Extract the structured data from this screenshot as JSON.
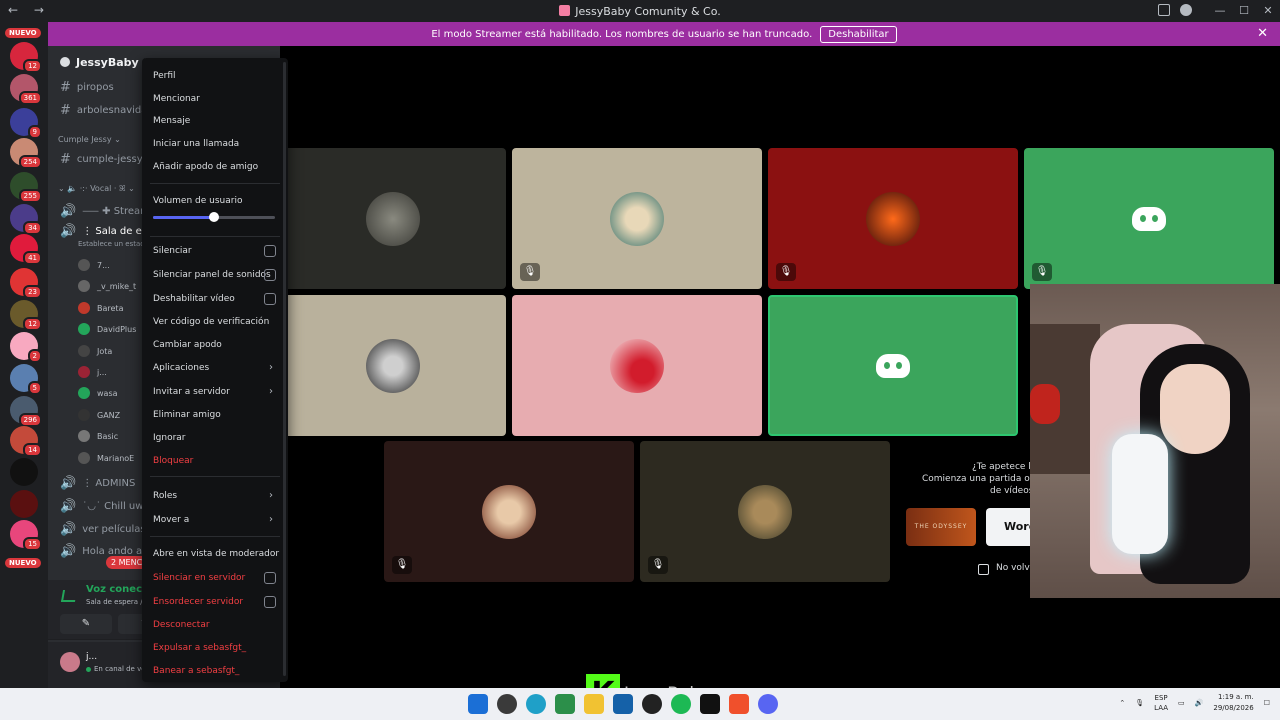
{
  "window": {
    "title": "JessyBaby Comunity & Co.",
    "nav": "← →"
  },
  "banner": {
    "text": "El modo Streamer está habilitado. Los nombres de usuario se han truncado.",
    "button": "Deshabilitar",
    "close": "✕"
  },
  "rail": {
    "top_badge": "NUEVO",
    "bottom_badge": "NUEVO",
    "servers": [
      {
        "badge": "12",
        "color": "#d7263d"
      },
      {
        "badge": "361",
        "color": "#b3566a"
      },
      {
        "badge": "9",
        "color": "#3b3f9a"
      },
      {
        "badge": "254",
        "color": "#c98a74"
      },
      {
        "badge": "255",
        "color": "#2e4d2b"
      },
      {
        "badge": "34",
        "color": "#4b3c8a"
      },
      {
        "badge": "41",
        "color": "#e01b3c"
      },
      {
        "badge": "23",
        "color": "#e03434"
      },
      {
        "badge": "12",
        "color": "#6a5a2b"
      },
      {
        "badge": "2",
        "color": "#f8a9c0"
      },
      {
        "badge": "5",
        "color": "#5a7fb0"
      },
      {
        "badge": "296",
        "color": "#4a5b6e"
      },
      {
        "badge": "14",
        "color": "#c44a3a"
      },
      {
        "badge": "",
        "color": "#111111"
      },
      {
        "badge": "",
        "color": "#5a1010"
      },
      {
        "badge": "15",
        "color": "#e8467c"
      }
    ]
  },
  "channels": {
    "server_name": "JessyBaby Co",
    "items": [
      {
        "label": "piropos",
        "type": "text"
      },
      {
        "label": "arbolesnavida",
        "type": "text"
      },
      {
        "label": "cumple-jessy",
        "type": "text"
      },
      {
        "label": "Stream",
        "type": "voice"
      },
      {
        "label": "Sala de esp",
        "type": "voice"
      },
      {
        "label": "ADMINS",
        "type": "voice"
      },
      {
        "label": "Chill uwu",
        "type": "voice"
      },
      {
        "label": "ver películas",
        "type": "text"
      },
      {
        "label": "Hola ando aqu",
        "type": "voice"
      }
    ],
    "categories": {
      "cumple": "Cumple Jessy",
      "vocal": "Vocal"
    },
    "status_hint": "Establece un estad",
    "members": [
      "7...",
      "_v_mike_t",
      "Bareta",
      "DavidPlus",
      "Jota",
      "j...",
      "wasa",
      "GANZ",
      "Basic",
      "MarianoE"
    ],
    "mentions": "2 MENCIO",
    "voice": {
      "status": "Voz conectada",
      "location": "Sala de espera / JessyBaby"
    },
    "user": {
      "name": "j...",
      "status": "En canal de voz"
    }
  },
  "context_menu": {
    "items": {
      "perfil": "Perfil",
      "mencionar": "Mencionar",
      "mensaje": "Mensaje",
      "llamada": "Iniciar una llamada",
      "apodo_amigo": "Añadir apodo de amigo",
      "volumen": "Volumen de usuario",
      "silenciar": "Silenciar",
      "silenciar_sonidos": "Silenciar panel de sonidos",
      "deshabilitar_video": "Deshabilitar vídeo",
      "codigo": "Ver código de verificación",
      "cambiar_apodo": "Cambiar apodo",
      "aplicaciones": "Aplicaciones",
      "invitar": "Invitar a servidor",
      "eliminar": "Eliminar amigo",
      "ignorar": "Ignorar",
      "bloquear": "Bloquear",
      "roles": "Roles",
      "mover": "Mover a",
      "moderador": "Abre en vista de moderador",
      "silenciar_servidor": "Silenciar en servidor",
      "ensordecer": "Ensordecer servidor",
      "desconectar": "Desconectar",
      "expulsar": "Expulsar a sebasfgt_",
      "banear": "Banear a sebasfgt_"
    },
    "volume_level": 0.5
  },
  "stage": {
    "activity": {
      "line1": "¿Te apetece ha",
      "line2": "Comienza una partida o una",
      "line3": "de vídeos al i",
      "card1": "THE ODYSSEY",
      "card2": "Word",
      "checkbox_label": "No volver"
    }
  },
  "overlay": {
    "k": "K",
    "name": "JessyBaby"
  },
  "taskbar": {
    "lang1": "ESP",
    "lang2": "LAA",
    "time": "1:19 a. m.",
    "date": "29/08/2026"
  }
}
